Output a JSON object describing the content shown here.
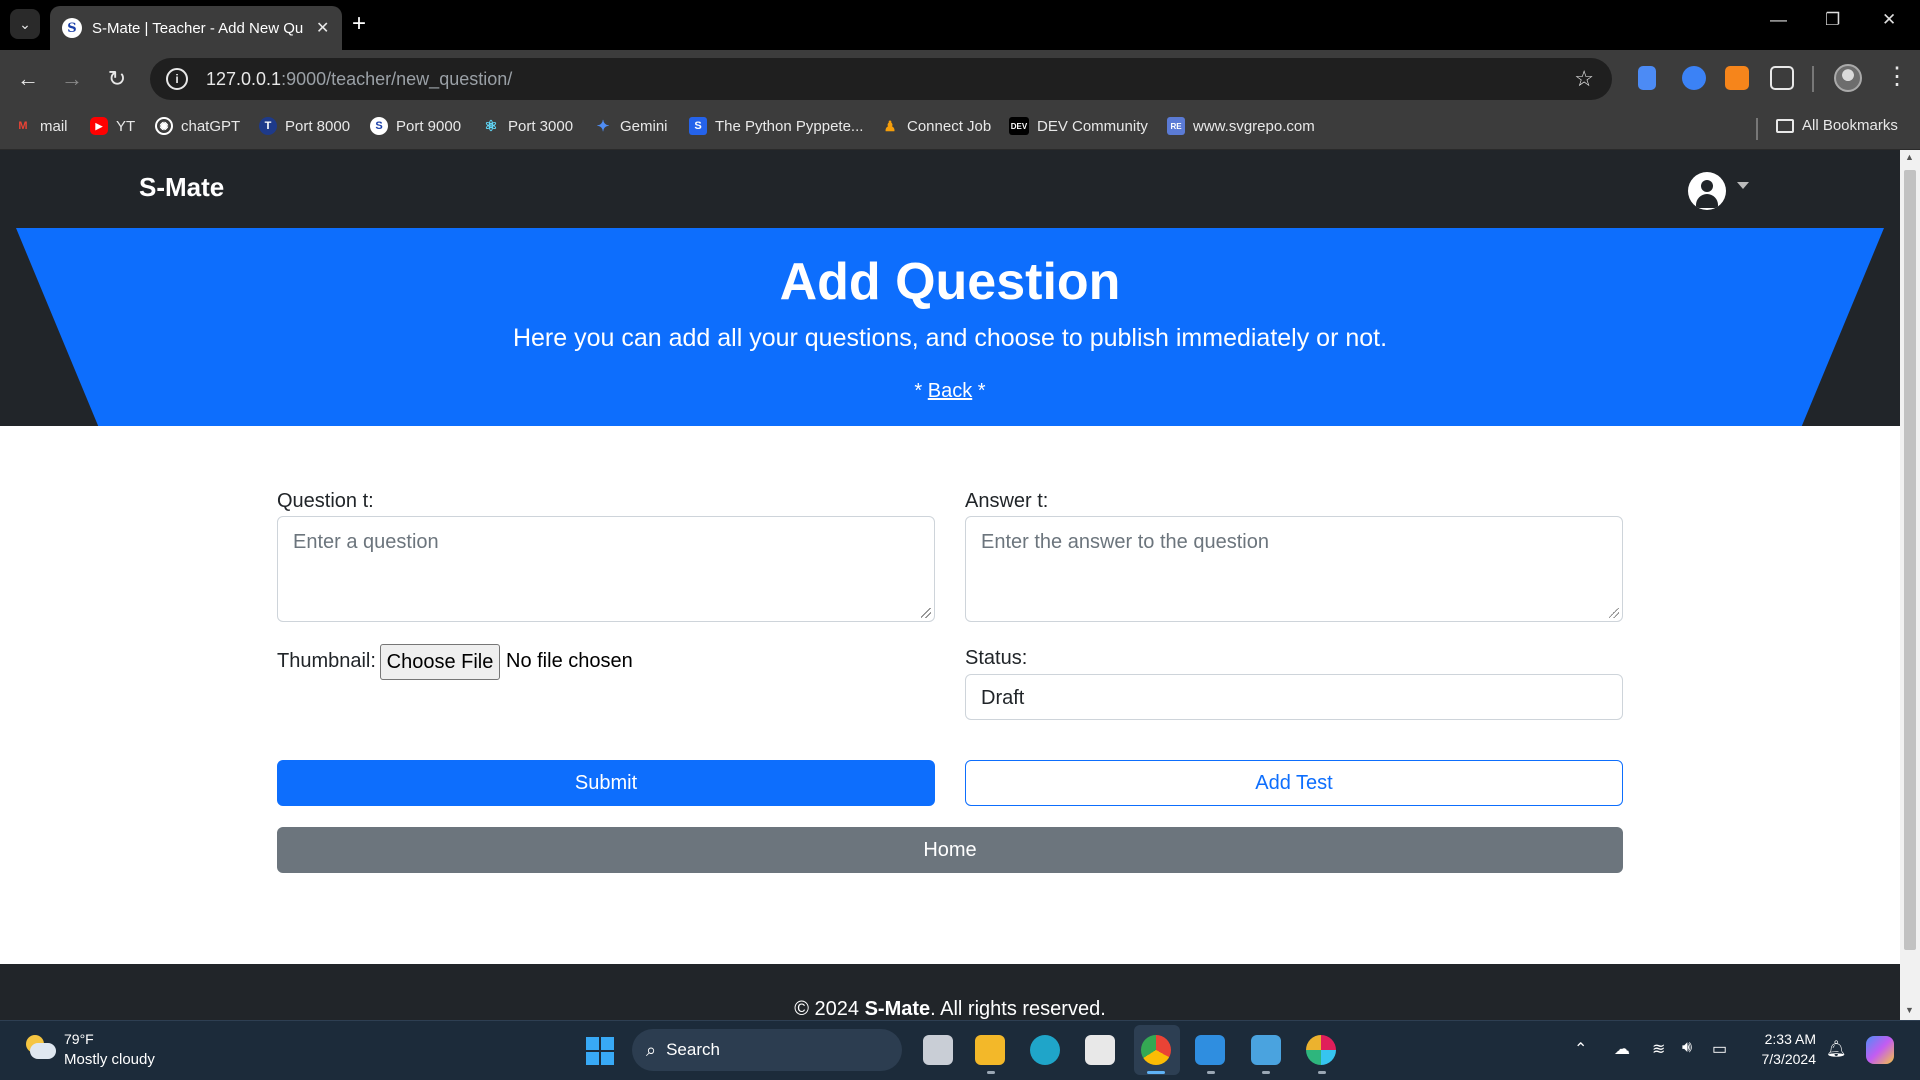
{
  "browser": {
    "tab_title": "S-Mate | Teacher - Add New Qu",
    "tab_favicon": "S",
    "url_host": "127.0.0.1",
    "url_rest": ":9000/teacher/new_question/",
    "bookmarks": [
      {
        "label": "mail",
        "icon": "gmail-icon",
        "color": "#ea4335"
      },
      {
        "label": "YT",
        "icon": "youtube-icon",
        "color": "#ff0000"
      },
      {
        "label": "chatGPT",
        "icon": "openai-icon",
        "color": "#ffffff"
      },
      {
        "label": "Port 8000",
        "icon": "tailwind-icon",
        "color": "#1e3a8a"
      },
      {
        "label": "Port 9000",
        "icon": "s-icon",
        "color": "#ffffff"
      },
      {
        "label": "Port 3000",
        "icon": "react-icon",
        "color": "#61dafb"
      },
      {
        "label": "Gemini",
        "icon": "gemini-icon",
        "color": "#4f8df5"
      },
      {
        "label": "The Python Pyppete...",
        "icon": "pyppeteer-icon",
        "color": "#2563eb"
      },
      {
        "label": "Connect Job",
        "icon": "connect-job-icon",
        "color": "#f59e0b"
      },
      {
        "label": "DEV Community",
        "icon": "dev-icon",
        "color": "#000000"
      },
      {
        "label": "www.svgrepo.com",
        "icon": "svgrepo-icon",
        "color": "#5b7bd5"
      }
    ],
    "all_bookmarks_label": "All Bookmarks"
  },
  "site": {
    "brand": "S-Mate",
    "hero_title": "Add Question",
    "hero_subtitle": "Here you can add all your questions, and choose to publish immediately or not.",
    "back_prefix": "* ",
    "back_link": "Back",
    "back_suffix": " *"
  },
  "form": {
    "question_label": "Question t:",
    "question_placeholder": "Enter a question",
    "answer_label": "Answer t:",
    "answer_placeholder": "Enter the answer to the question",
    "thumbnail_label": "Thumbnail:",
    "choose_file_label": "Choose File",
    "file_status": "No file chosen",
    "status_label": "Status:",
    "status_value": "Draft",
    "submit_label": "Submit",
    "add_test_label": "Add Test",
    "home_label": "Home"
  },
  "footer": {
    "prefix": "© 2024 ",
    "brand": "S-Mate",
    "suffix": ". All rights reserved."
  },
  "taskbar": {
    "temperature": "79°F",
    "weather": "Mostly cloudy",
    "search_label": "Search",
    "time": "2:33 AM",
    "date": "7/3/2024"
  },
  "colors": {
    "primary": "#0d6efd",
    "dark": "#212529",
    "secondary": "#6c757d"
  }
}
